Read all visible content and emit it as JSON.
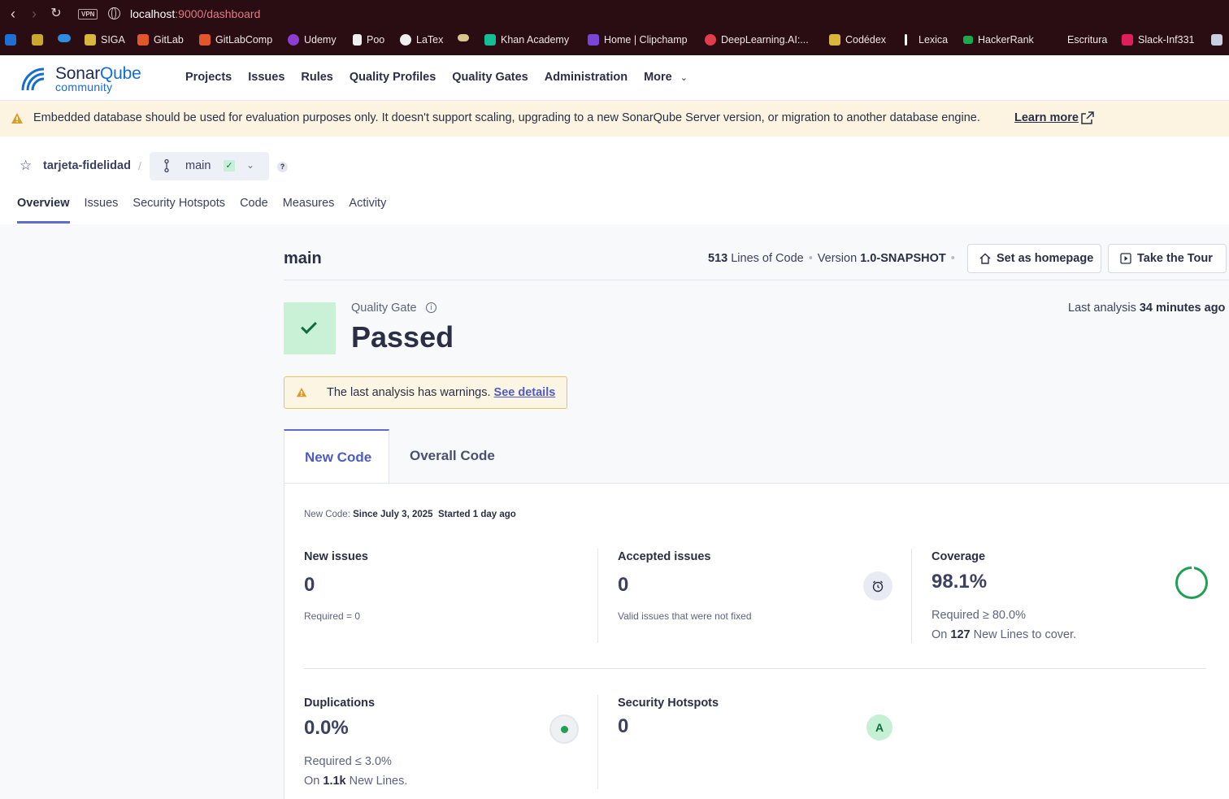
{
  "browser": {
    "url_host": "localhost",
    "url_path": ":9000/dashboard",
    "vpn_badge": "VPN",
    "bookmarks": [
      {
        "label": "",
        "icon": "outlook-icon",
        "color": "#1f6fd6"
      },
      {
        "label": "",
        "icon": "grid-icon",
        "color": "#caa82a"
      },
      {
        "label": "",
        "icon": "onedrive-icon",
        "color": "#2b8ee0"
      },
      {
        "label": "SIGA",
        "icon": "siga-icon",
        "color": "#d8b73a"
      },
      {
        "label": "GitLab",
        "icon": "gitlab-icon",
        "color": "#e2562b"
      },
      {
        "label": "GitLabComp",
        "icon": "gitlab-icon",
        "color": "#e2562b"
      },
      {
        "label": "Udemy",
        "icon": "udemy-icon",
        "color": "#8b3ed1"
      },
      {
        "label": "Poo",
        "icon": "document-icon",
        "color": "#f0f0f0"
      },
      {
        "label": "LaTex",
        "icon": "overleaf-icon",
        "color": "#f0f0f0"
      },
      {
        "label": "",
        "icon": "bowl-icon",
        "color": "#d9c68a"
      },
      {
        "label": "Khan Academy",
        "icon": "khan-icon",
        "color": "#14bf96"
      },
      {
        "label": "Home | Clipchamp",
        "icon": "clipchamp-icon",
        "color": "#7a45d6"
      },
      {
        "label": "DeepLearning.AI:...",
        "icon": "deeplearning-icon",
        "color": "#e23c4d"
      },
      {
        "label": "Codédex",
        "icon": "codedex-icon",
        "color": "#d8b73a"
      },
      {
        "label": "Lexica",
        "icon": "lexica-icon",
        "color": "#ffffff"
      },
      {
        "label": "HackerRank",
        "icon": "hackerrank-icon",
        "color": "#1ba94c"
      },
      {
        "label": "Escritura",
        "icon": "",
        "color": ""
      },
      {
        "label": "Slack-Inf331",
        "icon": "slack-icon",
        "color": "#e01e5a"
      },
      {
        "label": "",
        "icon": "folder-icon",
        "color": "#c8d0e0"
      }
    ]
  },
  "header": {
    "logo_main": "Sonar",
    "logo_accent": "Qube",
    "logo_sub": "community",
    "nav": [
      "Projects",
      "Issues",
      "Rules",
      "Quality Profiles",
      "Quality Gates",
      "Administration",
      "More"
    ]
  },
  "banner": {
    "message": "Embedded database should be used for evaluation purposes only. It doesn't support scaling, upgrading to a new SonarQube Server version, or migration to another database engine.",
    "link": "Learn more"
  },
  "project": {
    "name": "tarjeta-fidelidad",
    "separator": "/",
    "branch": "main",
    "help": "?",
    "tabs": [
      "Overview",
      "Issues",
      "Security Hotspots",
      "Code",
      "Measures",
      "Activity"
    ]
  },
  "overview": {
    "branch_title": "main",
    "loc_value": "513",
    "loc_label": "Lines of Code",
    "version_label": "Version",
    "version_value": "1.0-SNAPSHOT",
    "set_homepage": "Set as homepage",
    "take_tour": "Take the Tour",
    "quality_gate_label": "Quality Gate",
    "quality_gate_status": "Passed",
    "last_analysis_label": "Last analysis",
    "last_analysis_value": "34 minutes ago",
    "warning_text": "The last analysis has warnings.",
    "warning_link": "See details",
    "tab_new": "New Code",
    "tab_overall": "Overall Code",
    "new_code_label": "New Code:",
    "new_code_since": "Since July 3, 2025",
    "new_code_started": "Started 1 day ago"
  },
  "metrics": {
    "new_issues": {
      "title": "New issues",
      "value": "0",
      "sub": "Required = 0"
    },
    "accepted_issues": {
      "title": "Accepted issues",
      "value": "0",
      "sub": "Valid issues that were not fixed"
    },
    "coverage": {
      "title": "Coverage",
      "value": "98.1%",
      "required": "Required ≥ 80.0%",
      "on_prefix": "On",
      "on_value": "127",
      "on_suffix": "New Lines to cover."
    },
    "duplications": {
      "title": "Duplications",
      "value": "0.0%",
      "required": "Required ≤ 3.0%",
      "on_prefix": "On",
      "on_value": "1.1k",
      "on_suffix": "New Lines."
    },
    "security_hotspots": {
      "title": "Security Hotspots",
      "value": "0",
      "grade": "A"
    }
  },
  "colors": {
    "accent": "#5d6cd0",
    "passed_bg": "#c9f1d6",
    "passed_fg": "#0b6e3a",
    "banner_bg": "#fcf4e1"
  }
}
